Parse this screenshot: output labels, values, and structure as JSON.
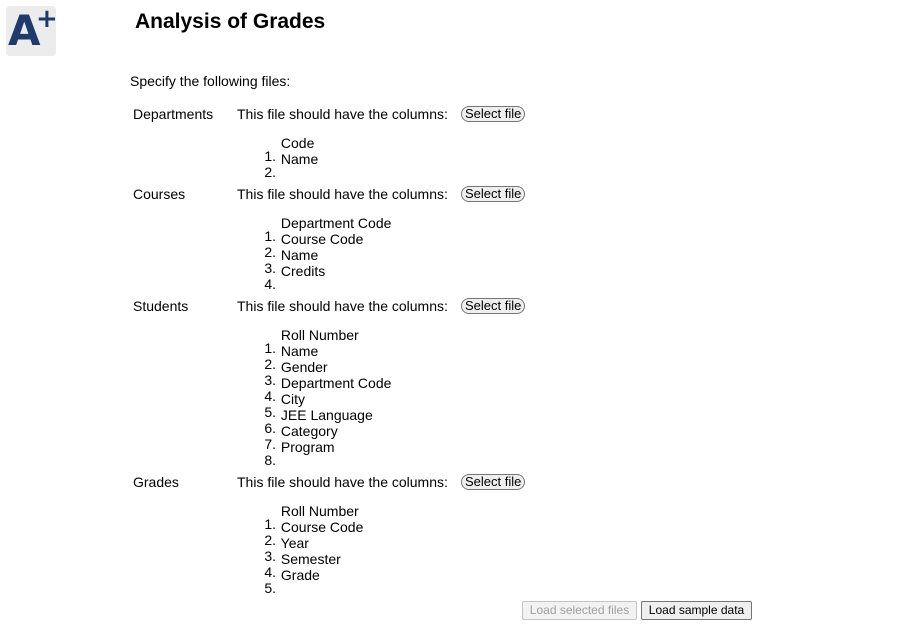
{
  "logo": {
    "letter": "A",
    "plus": "+"
  },
  "title": "Analysis of Grades",
  "intro": "Specify the following files:",
  "files": [
    {
      "name": "Departments",
      "desc": "This file should have the columns:",
      "button": "Select file",
      "columns": [
        "1.",
        "2."
      ],
      "column_names": [
        "Code",
        "Name"
      ]
    },
    {
      "name": "Courses",
      "desc": "This file should have the columns:",
      "button": "Select file",
      "columns": [
        "1.",
        "2.",
        "3.",
        "4."
      ],
      "column_names": [
        "Department Code",
        "Course Code",
        "Name",
        "Credits"
      ]
    },
    {
      "name": "Students",
      "desc": "This file should have the columns:",
      "button": "Select file",
      "columns": [
        "1.",
        "2.",
        "3.",
        "4.",
        "5.",
        "6.",
        "7.",
        "8."
      ],
      "column_names": [
        "Roll Number",
        "Name",
        "Gender",
        "Department Code",
        "City",
        "JEE Language",
        "Category",
        "Program"
      ]
    },
    {
      "name": "Grades",
      "desc": "This file should have the columns:",
      "button": "Select file",
      "columns": [
        "1.",
        "2.",
        "3.",
        "4.",
        "5."
      ],
      "column_names": [
        "Roll Number",
        "Course Code",
        "Year",
        "Semester",
        "Grade"
      ]
    }
  ],
  "actions": {
    "load_selected": "Load selected files",
    "load_sample": "Load sample data"
  }
}
